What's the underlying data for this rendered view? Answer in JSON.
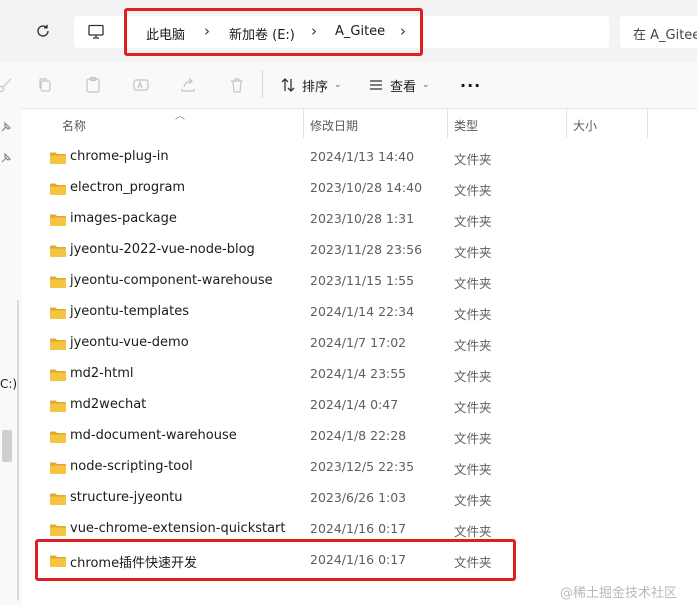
{
  "breadcrumb": {
    "items": [
      "此电脑",
      "新加卷 (E:)",
      "A_Gitee"
    ]
  },
  "search": {
    "placeholder": "在 A_Gitee"
  },
  "toolbar": {
    "sort_label": "排序",
    "view_label": "查看",
    "more_label": "···"
  },
  "nav_pane": {
    "drive_fragment": "C:)"
  },
  "columns": {
    "name": "名称",
    "modified": "修改日期",
    "type": "类型",
    "size": "大小"
  },
  "files": [
    {
      "name": "chrome-plug-in",
      "modified": "2024/1/13 14:40",
      "type": "文件夹"
    },
    {
      "name": "electron_program",
      "modified": "2023/10/28 14:40",
      "type": "文件夹"
    },
    {
      "name": "images-package",
      "modified": "2023/10/28 1:31",
      "type": "文件夹"
    },
    {
      "name": "jyeontu-2022-vue-node-blog",
      "modified": "2023/11/28 23:56",
      "type": "文件夹"
    },
    {
      "name": "jyeontu-component-warehouse",
      "modified": "2023/11/15 1:55",
      "type": "文件夹"
    },
    {
      "name": "jyeontu-templates",
      "modified": "2024/1/14 22:34",
      "type": "文件夹"
    },
    {
      "name": "jyeontu-vue-demo",
      "modified": "2024/1/7 17:02",
      "type": "文件夹"
    },
    {
      "name": "md2-html",
      "modified": "2024/1/4 23:55",
      "type": "文件夹"
    },
    {
      "name": "md2wechat",
      "modified": "2024/1/4 0:47",
      "type": "文件夹"
    },
    {
      "name": "md-document-warehouse",
      "modified": "2024/1/8 22:28",
      "type": "文件夹"
    },
    {
      "name": "node-scripting-tool",
      "modified": "2023/12/5 22:35",
      "type": "文件夹"
    },
    {
      "name": "structure-jyeontu",
      "modified": "2023/6/26 1:03",
      "type": "文件夹"
    },
    {
      "name": "vue-chrome-extension-quickstart",
      "modified": "2024/1/16 0:17",
      "type": "文件夹"
    },
    {
      "name": "chrome插件快速开发",
      "modified": "2024/1/16 0:17",
      "type": "文件夹"
    }
  ],
  "watermark": "@稀土掘金技术社区",
  "colors": {
    "highlight": "#e02020",
    "folder": "#f5c542",
    "folder_dark": "#e0a82e"
  }
}
